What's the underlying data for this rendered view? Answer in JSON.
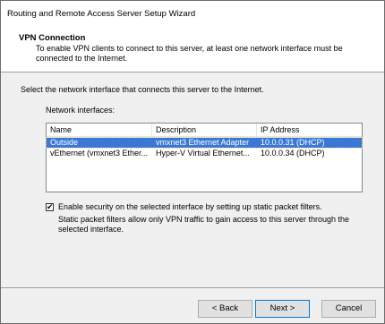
{
  "window": {
    "title": "Routing and Remote Access Server Setup Wizard"
  },
  "header": {
    "title": "VPN Connection",
    "description": "To enable VPN clients to connect to this server, at least one network interface must be connected to the Internet."
  },
  "instruction": "Select the network interface that connects this server to the Internet.",
  "network_interfaces": {
    "label": "Network interfaces:",
    "columns": [
      "Name",
      "Description",
      "IP Address"
    ],
    "rows": [
      {
        "name": "Outside",
        "description": "vmxnet3 Ethernet Adapter",
        "ip": "10.0.0.31 (DHCP)",
        "selected": true
      },
      {
        "name": "vEthernet (vmxnet3 Ether...",
        "description": "Hyper-V Virtual Ethernet...",
        "ip": "10.0.0.34 (DHCP)",
        "selected": false
      }
    ]
  },
  "security_option": {
    "checked": true,
    "label": "Enable security on the selected interface by setting up static packet filters.",
    "description": "Static packet filters allow only VPN traffic to gain access to this server through the selected interface."
  },
  "buttons": {
    "back": "< Back",
    "next": "Next >",
    "cancel": "Cancel"
  },
  "colors": {
    "selection": "#3a78d6",
    "default_button_border": "#0078d7"
  }
}
